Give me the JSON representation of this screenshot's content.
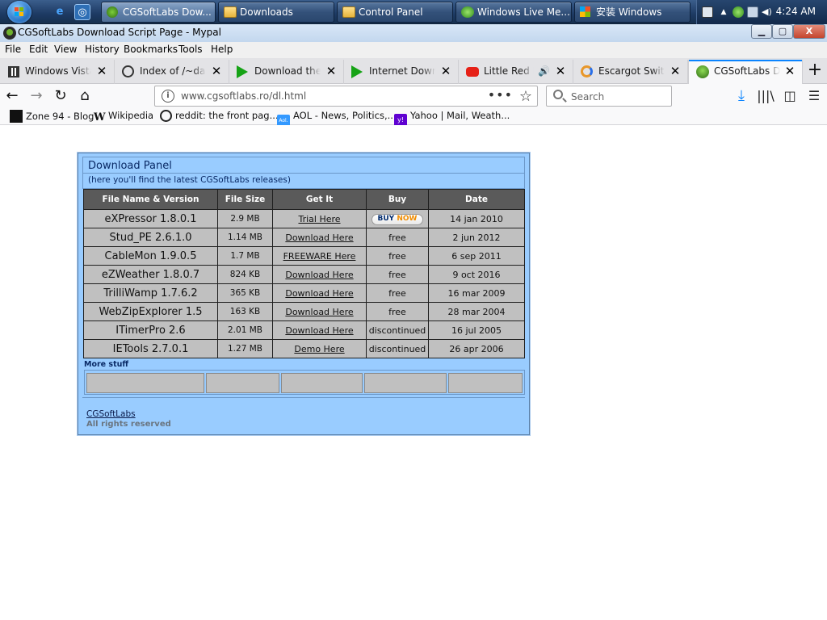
{
  "taskbar": {
    "buttons": [
      {
        "label": "CGSoftLabs Dow...",
        "icon": "alien-icon",
        "active": true
      },
      {
        "label": "Downloads",
        "icon": "folder-icon"
      },
      {
        "label": "Control Panel",
        "icon": "folder-icon"
      },
      {
        "label": "Windows Live Me...",
        "icon": "messenger-icon"
      },
      {
        "label": "安装 Windows",
        "icon": "windows-flag-icon"
      }
    ],
    "clock": "4:24 AM"
  },
  "window": {
    "title": "CGSoftLabs Download Script Page - Mypal",
    "controls": {
      "minimize": "▁",
      "maximize": "▢",
      "close": "X"
    }
  },
  "menu": [
    "File",
    "Edit",
    "View",
    "History",
    "Bookmarks",
    "Tools",
    "Help"
  ],
  "tabs": [
    {
      "label": "Windows Vista",
      "icon": "vista-columns-icon"
    },
    {
      "label": "Index of /~darts",
      "icon": "index-icon"
    },
    {
      "label": "Download the I",
      "icon": "green-arrow-icon"
    },
    {
      "label": "Internet Downlo",
      "icon": "green-arrow-icon"
    },
    {
      "label": "Little Red Ri",
      "icon": "youtube-icon",
      "audio": true
    },
    {
      "label": "Escargot Switch",
      "icon": "escargot-icon"
    },
    {
      "label": "CGSoftLabs Dow",
      "icon": "alien-icon",
      "active": true
    }
  ],
  "navbar": {
    "url": "www.cgsoftlabs.ro/dl.html",
    "search_placeholder": "Search"
  },
  "bookmarks": [
    {
      "label": "Zone 94 - Blog",
      "icon": "zone94-icon"
    },
    {
      "label": "Wikipedia",
      "icon": "wikipedia-icon"
    },
    {
      "label": "reddit: the front pag...",
      "icon": "globe-icon"
    },
    {
      "label": "AOL - News, Politics,...",
      "icon": "aol-icon"
    },
    {
      "label": "Yahoo | Mail, Weath...",
      "icon": "yahoo-icon"
    }
  ],
  "panel": {
    "title": "Download Panel",
    "subtitle": "(here you'll find the latest CGSoftLabs releases)",
    "columns": [
      "File Name & Version",
      "File Size",
      "Get It",
      "Buy",
      "Date"
    ],
    "rows": [
      {
        "name": "eXPressor 1.8.0.1",
        "size": "2.9 MB",
        "link": "Trial Here",
        "buy": "BUY NOW",
        "date": "14 jan 2010"
      },
      {
        "name": "Stud_PE 2.6.1.0",
        "size": "1.14 MB",
        "link": "Download Here",
        "buy": "free",
        "date": "2 jun 2012"
      },
      {
        "name": "CableMon 1.9.0.5",
        "size": "1.7 MB",
        "link": "FREEWARE Here",
        "buy": "free",
        "date": "6 sep 2011"
      },
      {
        "name": "eZWeather 1.8.0.7",
        "size": "824 KB",
        "link": "Download Here",
        "buy": "free",
        "date": "9 oct 2016"
      },
      {
        "name": "TrilliWamp 1.7.6.2",
        "size": "365 KB",
        "link": "Download Here",
        "buy": "free",
        "date": "16 mar 2009"
      },
      {
        "name": "WebZipExplorer 1.5",
        "size": "163 KB",
        "link": "Download Here",
        "buy": "free",
        "date": "28 mar 2004"
      },
      {
        "name": "ITimerPro 2.6",
        "size": "2.01 MB",
        "link": "Download Here",
        "buy": "discontinued",
        "date": "16 jul 2005"
      },
      {
        "name": "IETools 2.7.0.1",
        "size": "1.27 MB",
        "link": "Demo Here",
        "buy": "discontinued",
        "date": "26 apr 2006"
      }
    ],
    "buy_now": {
      "buy": "BUY",
      "now": "NOW"
    },
    "more_label": "More stuff",
    "footer_link": "CGSoftLabs",
    "footer_rights": "All rights reserved"
  },
  "colors": {
    "panel_bg": "#99ccff",
    "table_header": "#5a5a5a",
    "table_cell": "#c0c0c0",
    "active_tab_accent": "#0a84ff"
  }
}
